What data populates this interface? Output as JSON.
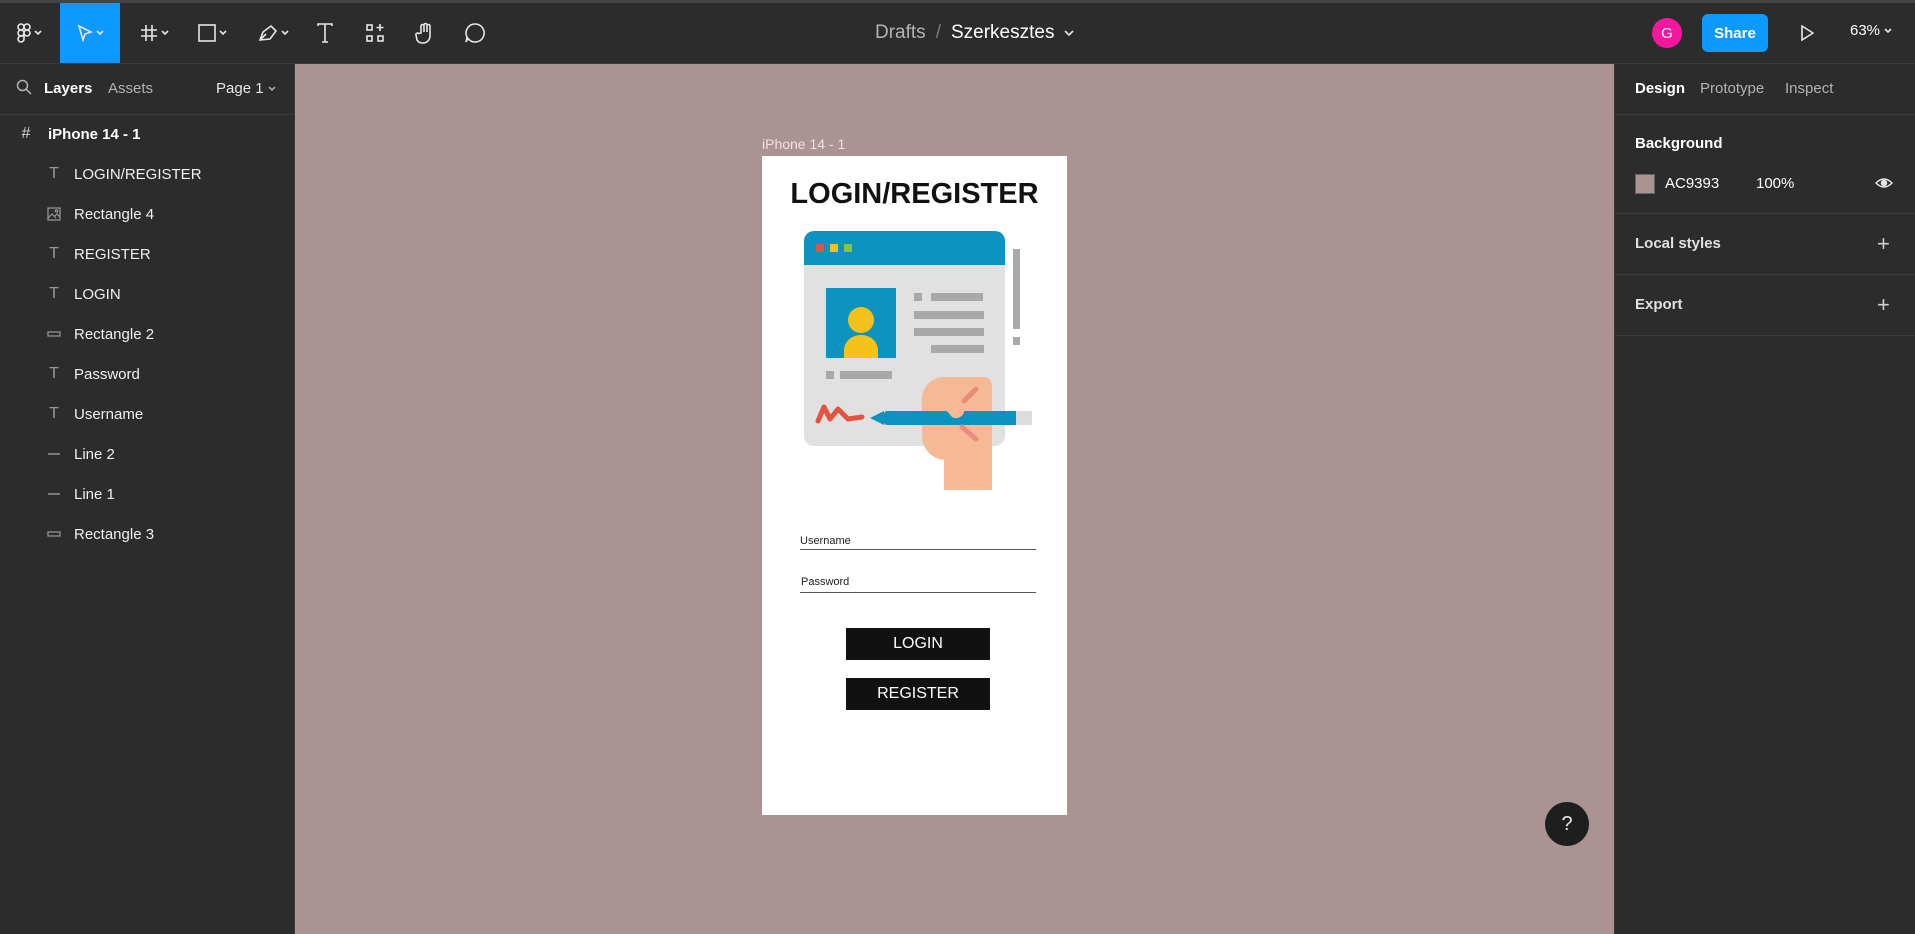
{
  "app": {
    "name": "Figma"
  },
  "toolbar": {
    "tools": [
      {
        "name": "main-menu",
        "icon": "figma-logo-icon"
      },
      {
        "name": "move",
        "icon": "move-cursor-icon",
        "active": true
      },
      {
        "name": "frame",
        "icon": "frame-hash-icon"
      },
      {
        "name": "shape",
        "icon": "rectangle-icon"
      },
      {
        "name": "pen",
        "icon": "pen-icon"
      },
      {
        "name": "text",
        "icon": "text-icon"
      },
      {
        "name": "resources",
        "icon": "components-icon"
      },
      {
        "name": "hand",
        "icon": "hand-icon"
      },
      {
        "name": "comment",
        "icon": "comment-icon"
      }
    ],
    "breadcrumb": {
      "drafts": "Drafts",
      "separator": "/",
      "file": "Szerkesztes"
    },
    "avatar_initial": "G",
    "share_label": "Share",
    "zoom": "63%"
  },
  "left_panel": {
    "tabs": {
      "layers": "Layers",
      "assets": "Assets"
    },
    "page": "Page 1",
    "layers": [
      {
        "name": "iPhone 14 - 1",
        "type": "frame"
      },
      {
        "name": "LOGIN/REGISTER",
        "type": "text"
      },
      {
        "name": "Rectangle 4",
        "type": "image"
      },
      {
        "name": "REGISTER",
        "type": "text"
      },
      {
        "name": "LOGIN",
        "type": "text"
      },
      {
        "name": "Rectangle 2",
        "type": "rectangle"
      },
      {
        "name": "Password",
        "type": "text"
      },
      {
        "name": "Username",
        "type": "text"
      },
      {
        "name": "Line 2",
        "type": "line"
      },
      {
        "name": "Line 1",
        "type": "line"
      },
      {
        "name": "Rectangle 3",
        "type": "rectangle"
      }
    ]
  },
  "canvas": {
    "background": "#AC9393",
    "frame_label": "iPhone 14 - 1",
    "screen": {
      "title": "LOGIN/REGISTER",
      "username_label": "Username",
      "password_label": "Password",
      "login_label": "LOGIN",
      "register_label": "REGISTER"
    },
    "help": "?"
  },
  "right_panel": {
    "tabs": {
      "design": "Design",
      "prototype": "Prototype",
      "inspect": "Inspect"
    },
    "background": {
      "heading": "Background",
      "hex": "AC9393",
      "opacity": "100%"
    },
    "local_styles": "Local styles",
    "export": "Export"
  },
  "colors": {
    "accent": "#0d99ff",
    "avatar": "#f5169e",
    "canvas": "#ac9393",
    "panel": "#2c2c2c"
  }
}
